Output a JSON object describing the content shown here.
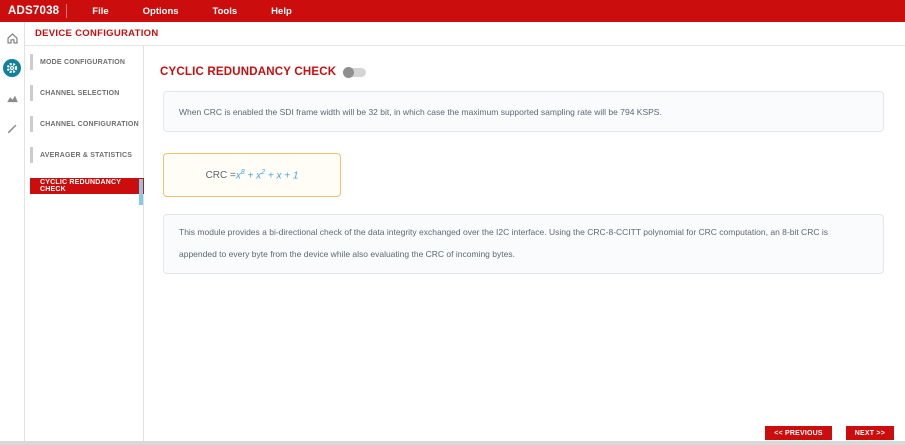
{
  "app": {
    "brand": "ADS7038",
    "menu": [
      "File",
      "Options",
      "Tools",
      "Help"
    ]
  },
  "rail_icons": [
    "home",
    "settings",
    "analytics",
    "edit"
  ],
  "panel": {
    "header": "DEVICE CONFIGURATION"
  },
  "nav": {
    "items": [
      {
        "label": "MODE CONFIGURATION",
        "selected": false
      },
      {
        "label": "CHANNEL SELECTION",
        "selected": false
      },
      {
        "label": "CHANNEL CONFIGURATION",
        "selected": false
      },
      {
        "label": "AVERAGER & STATISTICS",
        "selected": false
      },
      {
        "label": "CYCLIC REDUNDANCY CHECK",
        "selected": true
      }
    ]
  },
  "content": {
    "title": "CYCLIC REDUNDANCY CHECK",
    "crc_toggle_state": "off",
    "note1": "When CRC is enabled the SDI frame width will be 32 bit, in which case the maximum supported sampling rate will be 794 KSPS.",
    "formula": {
      "prefix": "CRC = ",
      "t1_base": "x",
      "t1_exp": "8",
      "t2_base": " + x",
      "t2_exp": "2",
      "t3": " + x + 1"
    },
    "note2": "This module provides a bi-directional check of the data integrity exchanged over the I2C interface. Using the CRC-8-CCITT polynomial for CRC computation, an 8-bit CRC is appended to every byte from the device while also evaluating the CRC of incoming bytes.",
    "buttons": {
      "previous": "<< PREVIOUS",
      "next": "NEXT >>"
    }
  },
  "colors": {
    "brand_red": "#cc0d0d",
    "rail_active_teal": "#11819b",
    "formula_blue": "#45a6dd",
    "formula_border": "#f0c36b",
    "scroll_thumb_blue": "#86cbe5"
  }
}
